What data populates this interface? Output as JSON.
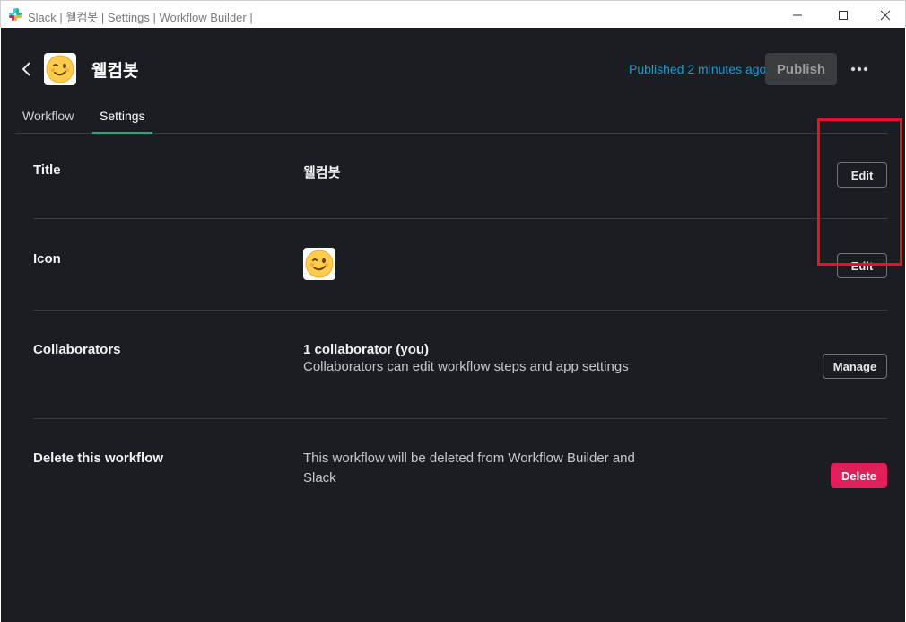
{
  "window": {
    "title": "Slack | 웰컴봇 | Settings | Workflow Builder |"
  },
  "header": {
    "workflow_name": "웰컴봇",
    "published_status": "Published 2 minutes ago",
    "publish_label": "Publish",
    "more_icon": "ellipsis-icon",
    "emoji": "winking-face"
  },
  "tabs": [
    {
      "label": "Workflow",
      "active": false
    },
    {
      "label": "Settings",
      "active": true
    }
  ],
  "settings": {
    "title_row": {
      "label": "Title",
      "value": "웰컴봇",
      "action": "Edit"
    },
    "icon_row": {
      "label": "Icon",
      "emoji": "winking-face",
      "action": "Edit"
    },
    "collaborators_row": {
      "label": "Collaborators",
      "value": "1 collaborator (you)",
      "description": "Collaborators can edit workflow steps and app settings",
      "action": "Manage"
    },
    "delete_row": {
      "label": "Delete this workflow",
      "description": "This workflow will be deleted from Workflow Builder and Slack",
      "action": "Delete"
    }
  },
  "colors": {
    "background": "#1a1d21",
    "link": "#1d9bd1",
    "danger": "#e01e5a",
    "tab_underline": "#2bac76",
    "annotation": "#e8102a"
  }
}
